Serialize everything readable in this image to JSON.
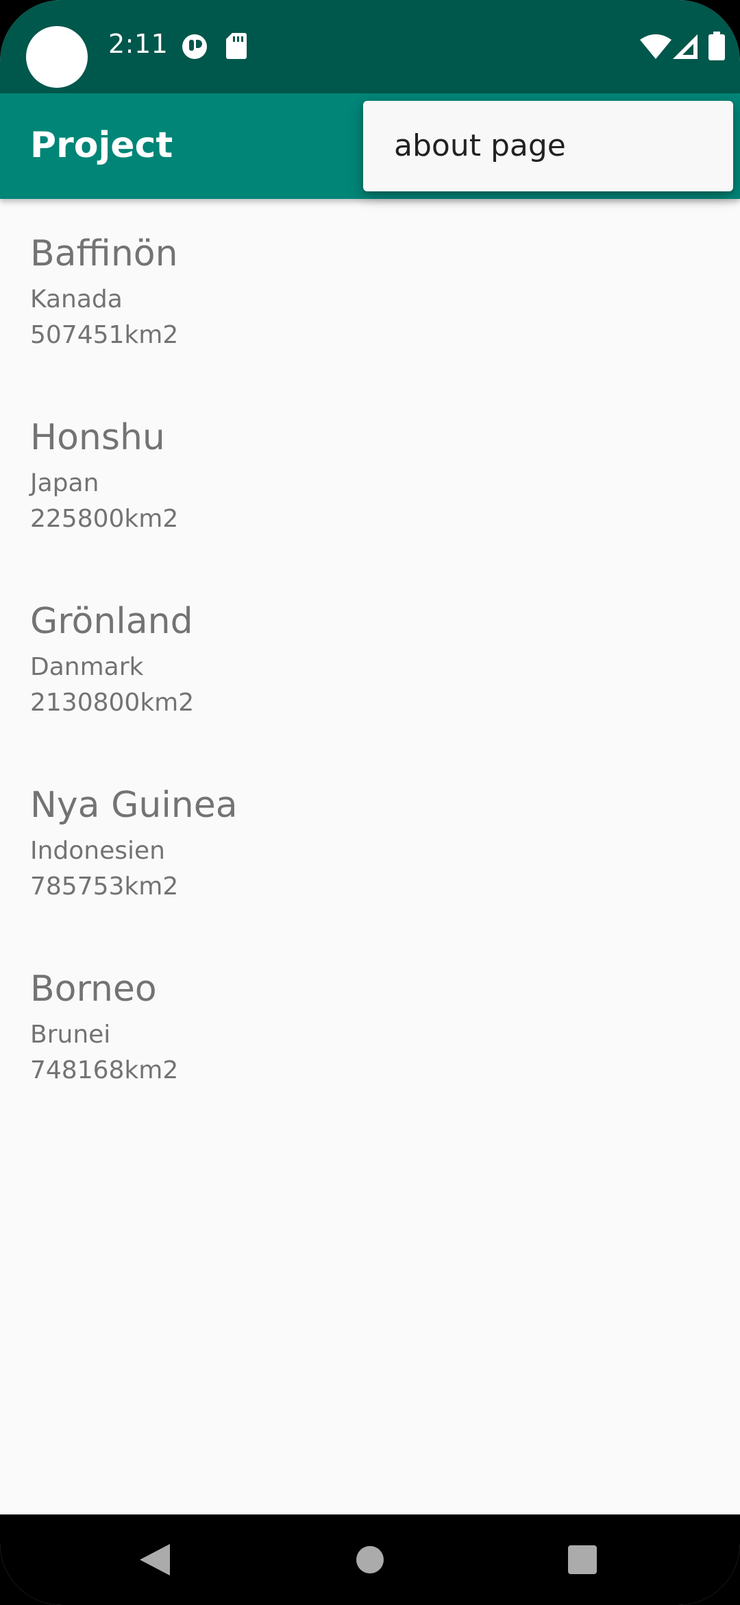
{
  "status_bar": {
    "time": "2:11",
    "icons": [
      "camera-cutout",
      "app-notification-icon",
      "sd-card-icon",
      "wifi-icon",
      "cellular-signal-icon",
      "battery-icon"
    ]
  },
  "app_bar": {
    "title": "Project"
  },
  "overflow_menu": {
    "items": [
      {
        "label": "about page"
      }
    ]
  },
  "islands": [
    {
      "name": "Baffinön",
      "country": "Kanada",
      "area": "507451km2"
    },
    {
      "name": "Honshu",
      "country": "Japan",
      "area": "225800km2"
    },
    {
      "name": "Grönland",
      "country": "Danmark",
      "area": "2130800km2"
    },
    {
      "name": "Nya Guinea",
      "country": "Indonesien",
      "area": "785753km2"
    },
    {
      "name": "Borneo",
      "country": "Brunei",
      "area": "748168km2"
    }
  ],
  "nav_bar": {
    "buttons": [
      "back-icon",
      "home-icon",
      "recents-icon"
    ]
  },
  "colors": {
    "status_bar": "#00574b",
    "app_bar": "#008577",
    "background": "#fafafa",
    "list_text": "#737373"
  }
}
